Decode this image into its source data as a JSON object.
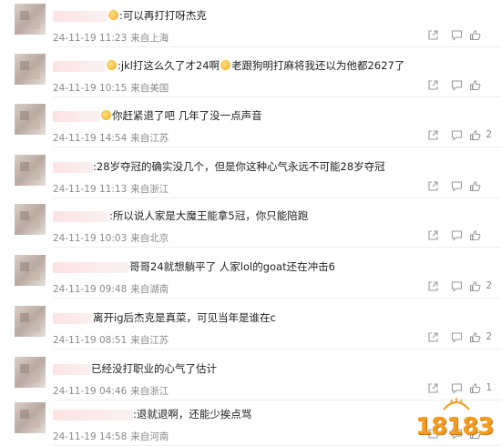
{
  "comments": [
    {
      "prefix": "",
      "emoji": true,
      "text": ":可以再打打呀杰克",
      "timestamp": "24-11-19 11:23",
      "source": "来自上海",
      "likes": ""
    },
    {
      "prefix": "",
      "emoji": true,
      "text": ":jkl打这么久了才24啊",
      "text2": "老跟狗明打麻将我还以为他都2627了",
      "timestamp": "24-11-19 10:15",
      "source": "来自美国",
      "likes": ""
    },
    {
      "prefix": "",
      "emoji": true,
      "text": "你赶紧退了吧 几年了没一点声音",
      "timestamp": "24-11-19 14:54",
      "source": "来自江苏",
      "likes": "2"
    },
    {
      "prefix": "",
      "emoji": false,
      "text": ":28岁夺冠的确实没几个，但是你这种心气永远不可能28岁夺冠",
      "timestamp": "24-11-19 11:13",
      "source": "来自浙江",
      "likes": ""
    },
    {
      "prefix": "",
      "emoji": false,
      "text": ":所以说人家是大魔王能拿5冠，你只能陪跑",
      "timestamp": "24-11-19 10:03",
      "source": "来自北京",
      "likes": ""
    },
    {
      "prefix": "",
      "emoji": false,
      "text": "哥哥24就想躺平了  人家lol的goat还在冲击6",
      "timestamp": "24-11-19 09:48",
      "source": "来自湖南",
      "likes": "2"
    },
    {
      "prefix": "",
      "emoji": false,
      "text": "离开ig后杰克是真菜，可见当年是谁在c",
      "timestamp": "24-11-19 08:51",
      "source": "来自江苏",
      "likes": "2"
    },
    {
      "prefix": "",
      "emoji": false,
      "text": "已经没打职业的心气了估计",
      "timestamp": "24-11-19 04:46",
      "source": "来自浙江",
      "likes": "1"
    },
    {
      "prefix": "",
      "emoji": false,
      "text": ":退就退啊，还能少挨点骂",
      "timestamp": "24-11-19 14:58",
      "source": "来自河南",
      "likes": ""
    }
  ],
  "watermark": {
    "text": "18183"
  },
  "icons": {
    "share": "share-icon",
    "comment": "comment-icon",
    "like": "thumbs-up-icon"
  },
  "colors": {
    "meta": "#8a8a8a",
    "watermark": "#f29b1d"
  }
}
